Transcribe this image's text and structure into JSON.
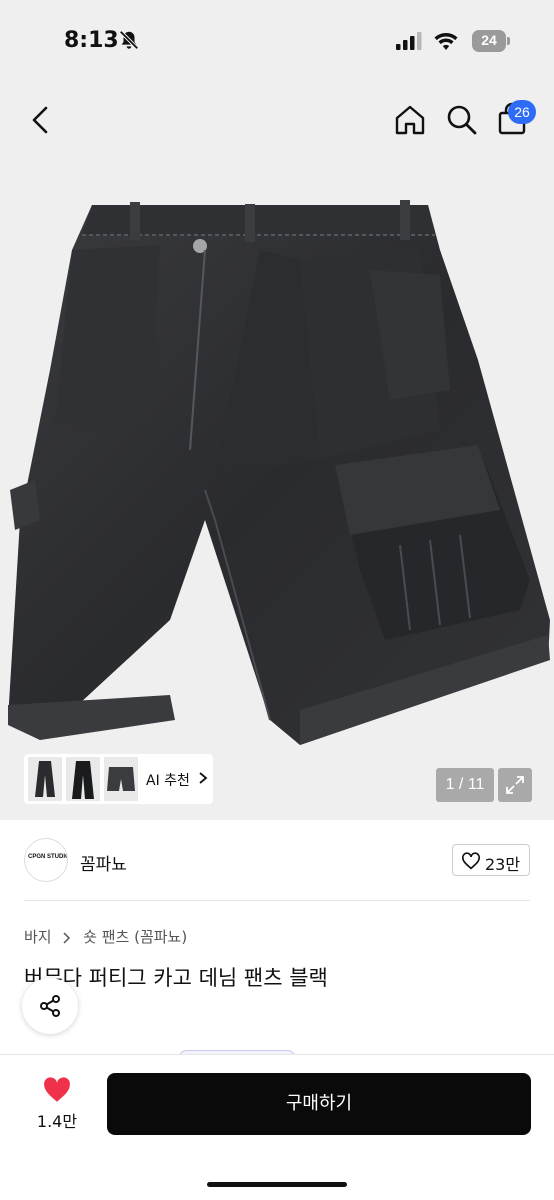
{
  "status_bar": {
    "time": "8:13",
    "battery": "24",
    "icons": [
      "bell-off-icon",
      "signal-icon",
      "wifi-icon",
      "battery-icon"
    ]
  },
  "header": {
    "icons": [
      "back-icon",
      "home-icon",
      "search-icon",
      "shopping-bag-icon"
    ],
    "cart_count": "26"
  },
  "gallery": {
    "ai_label": "AI 추천",
    "counter": "1 / 11",
    "image_description": "black denim cargo shorts"
  },
  "seller": {
    "logo_text": "CPGN STUDIO",
    "name": "꼼파뇨",
    "likes": "23만"
  },
  "breadcrumb": {
    "items": [
      "바지",
      "숏 팬츠 (꼼파뇨)"
    ]
  },
  "product": {
    "title": "버뮤다 퍼티그 카고 데님 팬츠 블랙"
  },
  "bottom_bar": {
    "like_count": "1.4만",
    "buy_label": "구매하기"
  },
  "colors": {
    "accent_badge": "#2e6cf6",
    "heart": "#f0314a",
    "buy_button": "#0a0a0a"
  }
}
